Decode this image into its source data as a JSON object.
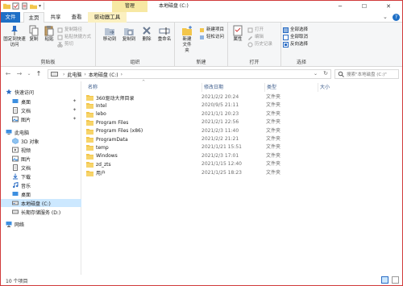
{
  "titlebar": {
    "manage_label": "管理",
    "title": "本地磁盘 (C:)",
    "minimize": "─",
    "maximize": "☐",
    "close": "✕"
  },
  "tabs": {
    "file": "文件",
    "home": "主页",
    "share": "共享",
    "view": "查看",
    "drive_tools": "驱动器工具"
  },
  "ribbon": {
    "clipboard": {
      "label": "剪贴板",
      "pin": "固定到快速访问",
      "copy": "复制",
      "paste": "粘贴",
      "copy_path": "复制路径",
      "paste_shortcut": "粘贴快捷方式",
      "cut": "剪切"
    },
    "organize": {
      "label": "组织",
      "move_to": "移动到",
      "copy_to": "复制到",
      "delete": "删除",
      "rename": "重命名"
    },
    "new": {
      "label": "新建",
      "new_folder": "新建文件夹",
      "new_item": "新建项目",
      "easy_access": "轻松访问"
    },
    "open": {
      "label": "打开",
      "properties": "属性",
      "open": "打开",
      "edit": "编辑",
      "history": "历史记录"
    },
    "select": {
      "label": "选择",
      "select_all": "全部选择",
      "select_none": "全部取消",
      "invert": "反向选择"
    }
  },
  "address": {
    "segments": [
      "此电脑",
      "本地磁盘 (C:)"
    ],
    "separator": "›",
    "search_placeholder": "搜索\"本地磁盘 (C:)\""
  },
  "navpane": {
    "items": [
      {
        "label": "快速访问"
      },
      {
        "label": "桌面"
      },
      {
        "label": "文档"
      },
      {
        "label": "图片"
      },
      {
        "label": "此电脑"
      },
      {
        "label": "3D 对象"
      },
      {
        "label": "视频"
      },
      {
        "label": "图片"
      },
      {
        "label": "文档"
      },
      {
        "label": "下载"
      },
      {
        "label": "音乐"
      },
      {
        "label": "桌面"
      },
      {
        "label": "本地磁盘 (C:)"
      },
      {
        "label": "长期存储服务 (D:)"
      },
      {
        "label": "网络"
      }
    ]
  },
  "filelist": {
    "columns": {
      "name": "名称",
      "date": "修改日期",
      "type": "类型",
      "size": "大小"
    },
    "rows": [
      {
        "name": "360驱动大师目录",
        "date": "2021/2/2 20:24",
        "type": "文件夹"
      },
      {
        "name": "Intel",
        "date": "2020/9/5 21:11",
        "type": "文件夹"
      },
      {
        "name": "lebo",
        "date": "2021/1/1 20:23",
        "type": "文件夹"
      },
      {
        "name": "Program Files",
        "date": "2021/2/1 22:56",
        "type": "文件夹"
      },
      {
        "name": "Program Files (x86)",
        "date": "2021/2/3 11:40",
        "type": "文件夹"
      },
      {
        "name": "ProgramData",
        "date": "2021/2/2 21:21",
        "type": "文件夹"
      },
      {
        "name": "temp",
        "date": "2021/1/21 15:51",
        "type": "文件夹"
      },
      {
        "name": "Windows",
        "date": "2021/2/3 17:01",
        "type": "文件夹"
      },
      {
        "name": "zd_zts",
        "date": "2021/1/15 12:40",
        "type": "文件夹"
      },
      {
        "name": "用户",
        "date": "2021/1/25 18:23",
        "type": "文件夹"
      }
    ]
  },
  "status": {
    "count": "10 个项目"
  },
  "colors": {
    "accent": "#1e6fc6",
    "selection": "#cce8ff",
    "folder": "#f3c64b",
    "window_border": "#d13a3a"
  }
}
